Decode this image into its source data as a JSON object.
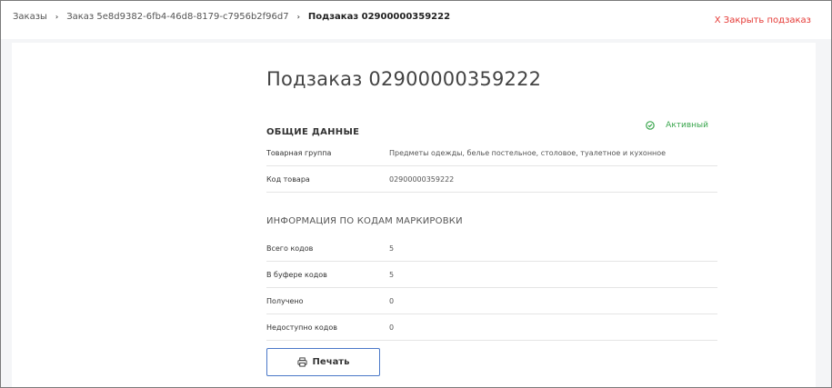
{
  "breadcrumb": {
    "items": [
      "Заказы",
      "Заказ 5e8d9382-6fb4-46d8-8179-c7956b2f96d7",
      "Подзаказ 02900000359222"
    ]
  },
  "header": {
    "close_label": "X Закрыть подзаказ"
  },
  "main": {
    "title": "Подзаказ 02900000359222",
    "general": {
      "heading": "ОБЩИЕ ДАННЫЕ",
      "status": "Активный",
      "rows": [
        {
          "label": "Товарная группа",
          "value": "Предметы одежды, белье постельное, столовое, туалетное и кухонное"
        },
        {
          "label": "Код товара",
          "value": "02900000359222"
        }
      ]
    },
    "codes": {
      "heading": "ИНФОРМАЦИЯ ПО КОДАМ МАРКИРОВКИ",
      "rows": [
        {
          "label": "Всего кодов",
          "value": "5"
        },
        {
          "label": "В буфере кодов",
          "value": "5"
        },
        {
          "label": "Получено",
          "value": "0"
        },
        {
          "label": "Недоступно кодов",
          "value": "0"
        }
      ]
    },
    "print_label": "Печать"
  },
  "colors": {
    "status": "#3aa64e",
    "close": "#e53935",
    "button_border": "#4a78c8"
  },
  "icons": {
    "status": "check-circle-icon",
    "print": "printer-icon",
    "separator": "chevron-right-icon"
  }
}
